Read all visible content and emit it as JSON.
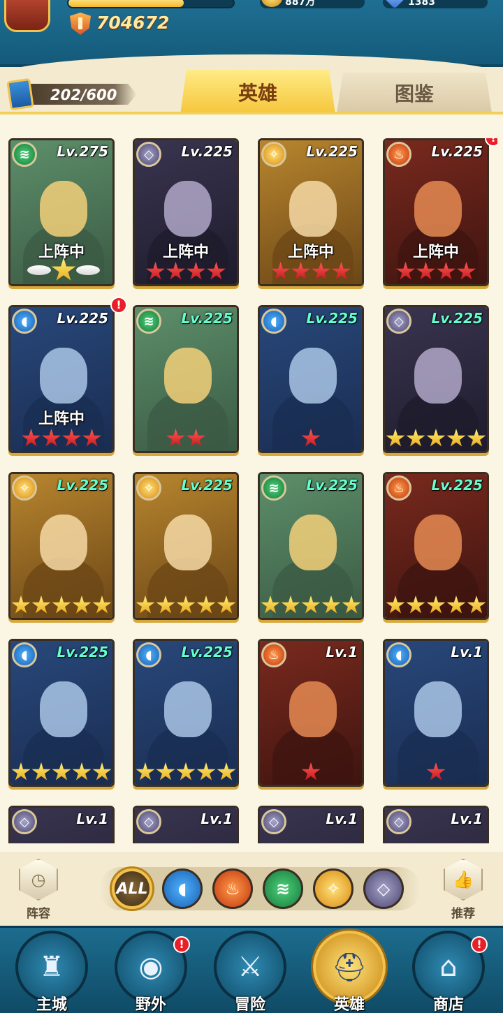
{
  "header": {
    "power_value": "704672",
    "resource_1_value": "887万",
    "resource_2_value": "1383"
  },
  "hero_count": "202/600",
  "tabs": [
    {
      "label": "英雄",
      "active": true
    },
    {
      "label": "图鉴",
      "active": false
    }
  ],
  "heroes": [
    {
      "element": "wind",
      "level": "Lv.275",
      "status": "上阵中",
      "stars": 1,
      "star_color": "gold",
      "winged": true,
      "alert": false,
      "level_color": "white"
    },
    {
      "element": "dark",
      "level": "Lv.225",
      "status": "上阵中",
      "stars": 4,
      "star_color": "red",
      "alert": false,
      "level_color": "white"
    },
    {
      "element": "light",
      "level": "Lv.225",
      "status": "上阵中",
      "stars": 4,
      "star_color": "red",
      "alert": false,
      "level_color": "white"
    },
    {
      "element": "fire",
      "level": "Lv.225",
      "status": "上阵中",
      "stars": 4,
      "star_color": "red",
      "alert": true,
      "level_color": "white"
    },
    {
      "element": "water",
      "level": "Lv.225",
      "status": "上阵中",
      "stars": 4,
      "star_color": "red",
      "alert": true,
      "level_color": "white"
    },
    {
      "element": "wind",
      "level": "Lv.225",
      "status": "",
      "stars": 2,
      "star_color": "red",
      "alert": false,
      "level_color": "green"
    },
    {
      "element": "water",
      "level": "Lv.225",
      "status": "",
      "stars": 1,
      "star_color": "red",
      "alert": false,
      "level_color": "green"
    },
    {
      "element": "dark",
      "level": "Lv.225",
      "status": "",
      "stars": 5,
      "star_color": "gold",
      "alert": false,
      "level_color": "green"
    },
    {
      "element": "light",
      "level": "Lv.225",
      "status": "",
      "stars": 5,
      "star_color": "gold",
      "alert": false,
      "level_color": "green"
    },
    {
      "element": "light",
      "level": "Lv.225",
      "status": "",
      "stars": 5,
      "star_color": "gold",
      "alert": false,
      "level_color": "green"
    },
    {
      "element": "wind",
      "level": "Lv.225",
      "status": "",
      "stars": 5,
      "star_color": "gold",
      "alert": false,
      "level_color": "green"
    },
    {
      "element": "fire",
      "level": "Lv.225",
      "status": "",
      "stars": 5,
      "star_color": "gold",
      "alert": false,
      "level_color": "green"
    },
    {
      "element": "water",
      "level": "Lv.225",
      "status": "",
      "stars": 5,
      "star_color": "gold",
      "alert": false,
      "level_color": "green"
    },
    {
      "element": "water",
      "level": "Lv.225",
      "status": "",
      "stars": 5,
      "star_color": "gold",
      "alert": false,
      "level_color": "green"
    },
    {
      "element": "fire",
      "level": "Lv.1",
      "status": "",
      "stars": 1,
      "star_color": "red",
      "alert": false,
      "level_color": "white"
    },
    {
      "element": "water",
      "level": "Lv.1",
      "status": "",
      "stars": 1,
      "star_color": "red",
      "alert": false,
      "level_color": "white"
    },
    {
      "element": "dark",
      "level": "Lv.1",
      "status": "",
      "stars": 0,
      "star_color": "red",
      "alert": false,
      "level_color": "white"
    },
    {
      "element": "dark",
      "level": "Lv.1",
      "status": "",
      "stars": 0,
      "star_color": "red",
      "alert": false,
      "level_color": "white"
    },
    {
      "element": "dark",
      "level": "Lv.1",
      "status": "",
      "stars": 0,
      "star_color": "red",
      "alert": false,
      "level_color": "white"
    },
    {
      "element": "dark",
      "level": "Lv.1",
      "status": "",
      "stars": 0,
      "star_color": "red",
      "alert": false,
      "level_color": "white"
    }
  ],
  "filter": {
    "left_button_label": "阵容",
    "right_button_label": "推荐",
    "all_label": "ALL",
    "elements": [
      "water",
      "fire",
      "wind",
      "light",
      "dark"
    ]
  },
  "bottom_nav": [
    {
      "label": "主城",
      "icon": "castle-icon",
      "active": false,
      "alert": false
    },
    {
      "label": "野外",
      "icon": "portal-icon",
      "active": false,
      "alert": true
    },
    {
      "label": "冒险",
      "icon": "sword-icon",
      "active": false,
      "alert": false
    },
    {
      "label": "英雄",
      "icon": "helmet-icon",
      "active": true,
      "alert": false
    },
    {
      "label": "商店",
      "icon": "shop-icon",
      "active": false,
      "alert": true
    }
  ],
  "colors": {
    "wind": "#1f9a4e",
    "water": "#2a7fd1",
    "fire": "#d9471a",
    "light": "#e8a21d",
    "dark": "#5f5a8a"
  },
  "alert_mark": "!"
}
